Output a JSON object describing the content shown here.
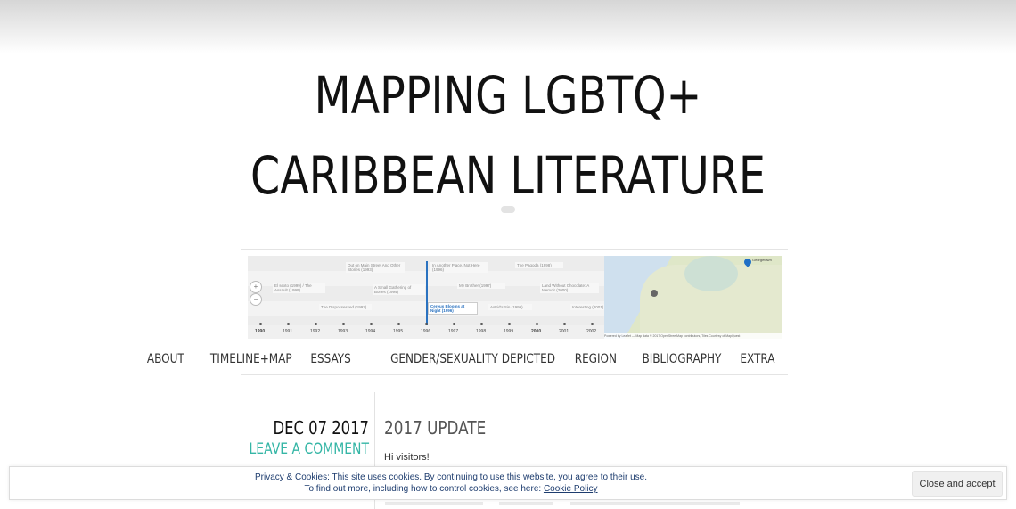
{
  "site": {
    "title_line1": "MAPPING LGBTQ+",
    "title_line2": "CARIBBEAN LITERATURE"
  },
  "header_image": {
    "timeline_events": [
      "El sexto (1999) / The Assault (1999)",
      "Out on Main Street And Other Stories (1993)",
      "A Small Gathering of Bones (1994)",
      "The Dispossessed (1992)",
      "In Another Place, Not Here (1996)",
      "My Brother (1997)",
      "Cereus Blooms at Night (1996)",
      "Astrid's Sin (1999)",
      "The Pagoda (1998)",
      "Land Without Chocolate: A Memoir (2000)",
      "Interesting (2001)"
    ],
    "years": [
      "1990",
      "1991",
      "1992",
      "1993",
      "1994",
      "1995",
      "1996",
      "1997",
      "1998",
      "1999",
      "2000",
      "2001",
      "2002"
    ],
    "map_label": "Georgetown",
    "map_attribution": "Powered by Leaflet — Map data © 2017 OpenStreetMap contributors, Tiles Courtesy of MapQuest"
  },
  "nav": {
    "items": [
      "ABOUT",
      "TIMELINE+MAP",
      "ESSAYS",
      "GENDER/SEXUALITY DEPICTED",
      "REGION",
      "BIBLIOGRAPHY",
      "EXTRA"
    ]
  },
  "post": {
    "date": "DEC 07 2017",
    "comment_link": "LEAVE A COMMENT",
    "title": "2017 UPDATE",
    "body": "Hi visitors!"
  },
  "cookie_banner": {
    "line1": "Privacy & Cookies: This site uses cookies. By continuing to use this website, you agree to their use.",
    "line2_prefix": "To find out more, including how to control cookies, see here: ",
    "policy_link": "Cookie Policy",
    "accept_button": "Close and accept"
  }
}
